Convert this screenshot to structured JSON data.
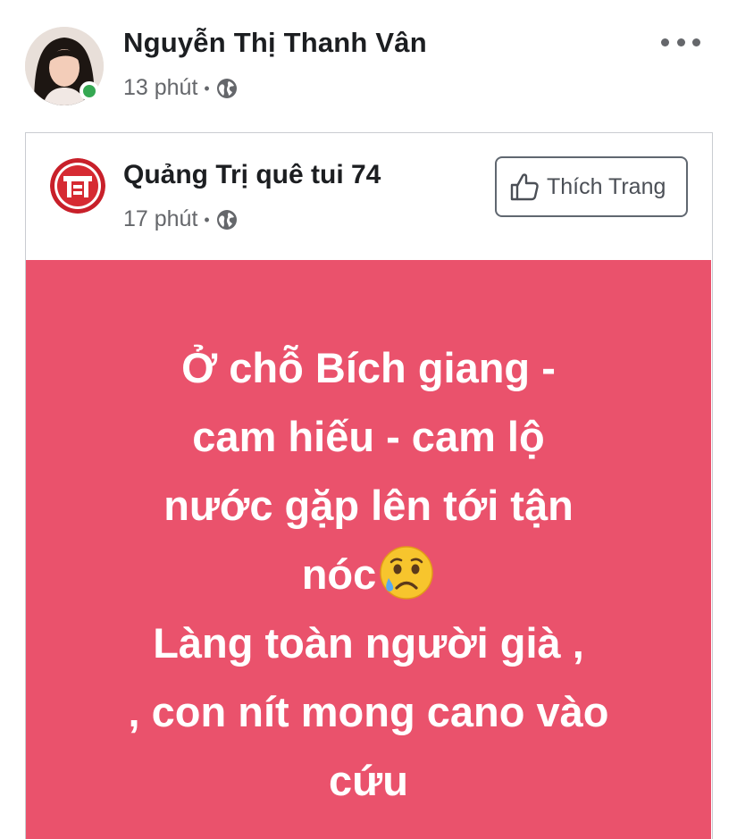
{
  "post": {
    "author_name": "Nguyễn Thị Thanh Vân",
    "time": "13 phút",
    "separator": "•",
    "privacy_icon": "globe-icon",
    "online": true,
    "more_icon": "more-horizontal-icon"
  },
  "shared_post": {
    "page_name": "Quảng Trị quê tui 74",
    "time": "17 phút",
    "separator": "•",
    "privacy_icon": "globe-icon",
    "like_button_label": "Thích Trang",
    "like_icon": "thumbs-up-icon",
    "background_color": "#ea526c",
    "text_lines": [
      "Ở chỗ Bích giang -",
      "cam hiếu - cam lộ",
      "nước gặp lên tới tận",
      "nóc",
      "Làng toàn người già ,",
      ", con nít mong cano vào",
      "cứu"
    ],
    "emoji": "crying-face-emoji"
  },
  "colors": {
    "online": "#35a852",
    "text_primary": "#1c1e21",
    "text_secondary": "#65676b"
  }
}
